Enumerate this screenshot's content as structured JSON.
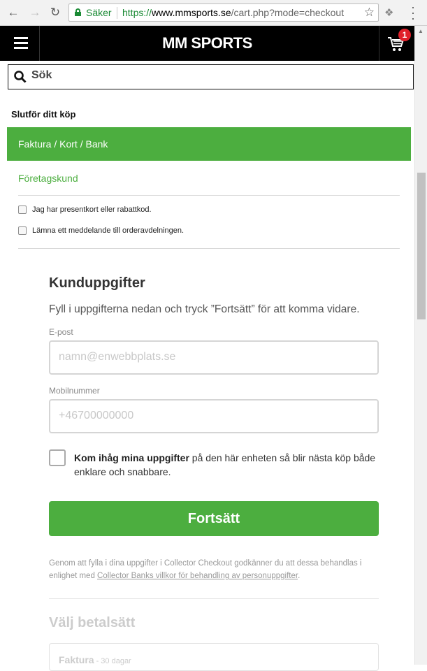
{
  "browser": {
    "secure_label": "Säker",
    "url_prefix": "https://",
    "url_host": "www.mmsports.se",
    "url_path": "/cart.php?mode=checkout"
  },
  "header": {
    "logo": "MM SPORTS",
    "cart_count": "1"
  },
  "search": {
    "placeholder": "Sök"
  },
  "checkout": {
    "title": "Slutför ditt köp",
    "payment_tab_active": "Faktura / Kort / Bank",
    "payment_tab_company": "Företagskund",
    "giftcard_label": "Jag har presentkort eller rabattkod.",
    "message_label": "Lämna ett meddelande till orderavdelningen."
  },
  "customer": {
    "heading": "Kunduppgifter",
    "intro": "Fyll i uppgifterna nedan och tryck ”Fortsätt” för att komma vidare.",
    "email_label": "E-post",
    "email_placeholder": "namn@enwebbplats.se",
    "phone_label": "Mobilnummer",
    "phone_placeholder": "+46700000000",
    "remember_bold": "Kom ihåg mina uppgifter",
    "remember_rest": " på den här enheten så blir nästa köp både enklare och snabbare.",
    "continue_label": "Fortsätt",
    "legal_text": "Genom att fylla i dina uppgifter i Collector Checkout godkänner du att dessa behandlas i enlighet med ",
    "legal_link": "Collector Banks villkor för behandling av personuppgifter",
    "legal_end": "."
  },
  "payment": {
    "heading": "Välj betalsätt",
    "method_name": "Faktura",
    "method_sub": "- 30 dagar"
  },
  "colors": {
    "accent_green": "#4cae3f",
    "badge_red": "#e0202a",
    "secure_green": "#1a8a34"
  }
}
